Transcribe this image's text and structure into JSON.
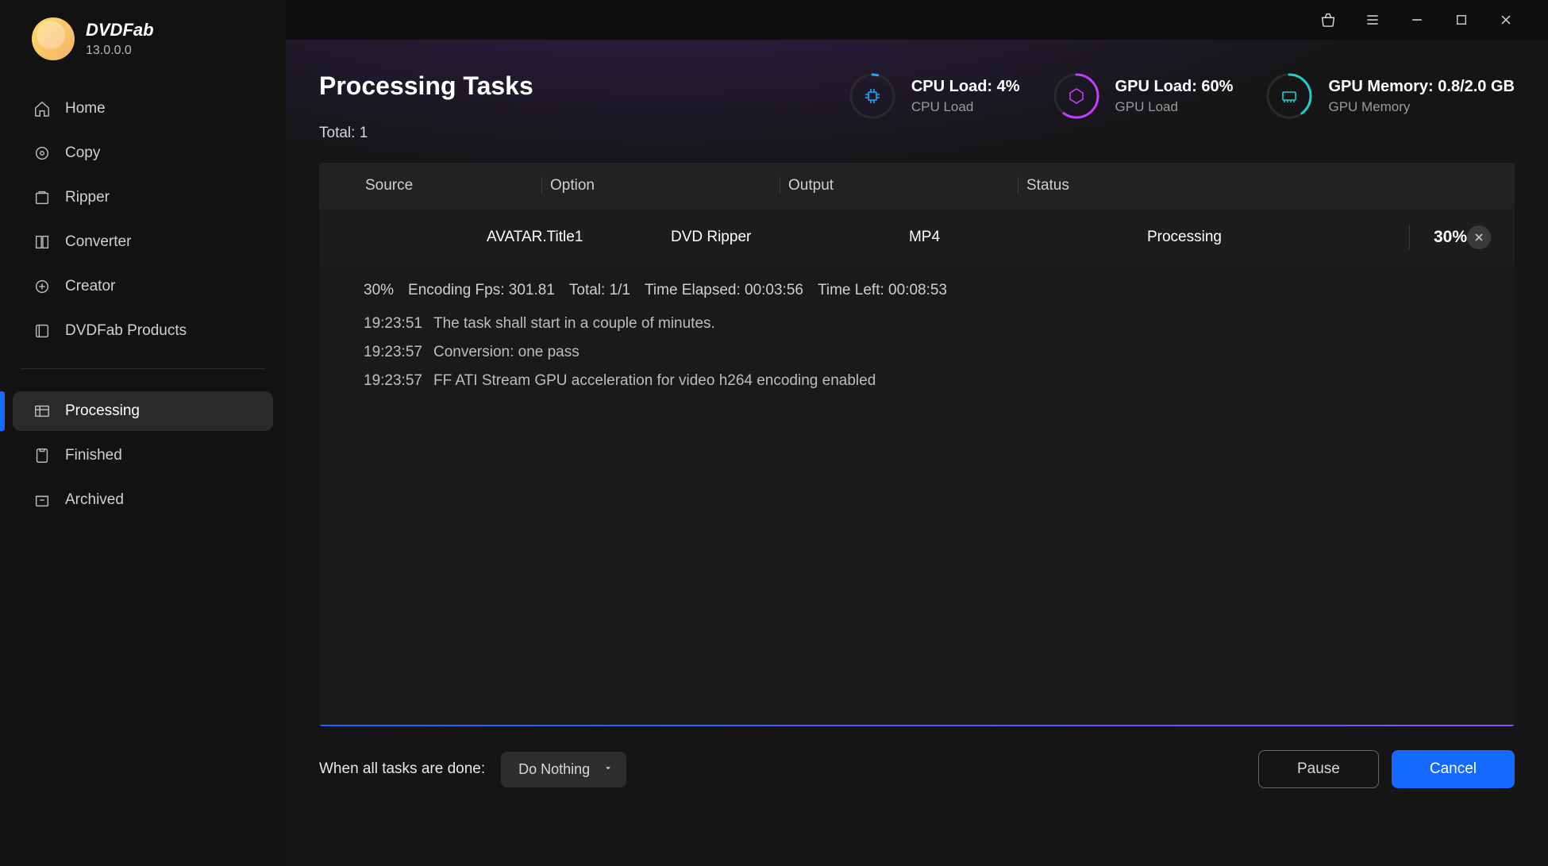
{
  "app": {
    "name": "DVDFab",
    "version": "13.0.0.0"
  },
  "sidebar": {
    "items": [
      {
        "label": "Home",
        "icon": "home-icon"
      },
      {
        "label": "Copy",
        "icon": "copy-icon"
      },
      {
        "label": "Ripper",
        "icon": "ripper-icon"
      },
      {
        "label": "Converter",
        "icon": "converter-icon"
      },
      {
        "label": "Creator",
        "icon": "creator-icon"
      },
      {
        "label": "DVDFab Products",
        "icon": "products-icon"
      }
    ],
    "taskItems": [
      {
        "label": "Processing",
        "icon": "processing-icon",
        "active": true
      },
      {
        "label": "Finished",
        "icon": "finished-icon"
      },
      {
        "label": "Archived",
        "icon": "archived-icon"
      }
    ]
  },
  "header": {
    "title": "Processing Tasks",
    "total": "Total: 1",
    "cpu": {
      "title": "CPU Load: 4%",
      "sub": "CPU Load",
      "pct": 4,
      "color": "#1aa8ff"
    },
    "gpu": {
      "title": "GPU Load: 60%",
      "sub": "GPU Load",
      "pct": 60,
      "color": "#c23cff"
    },
    "mem": {
      "title": "GPU Memory: 0.8/2.0 GB",
      "sub": "GPU Memory",
      "pct": 40,
      "color": "#1ed0c9"
    }
  },
  "table": {
    "headers": {
      "source": "Source",
      "option": "Option",
      "output": "Output",
      "status": "Status"
    },
    "task": {
      "source": "AVATAR.Title1",
      "option": "DVD Ripper",
      "output": "MP4",
      "status": "Processing",
      "percent": "30%",
      "progress": 30
    }
  },
  "log": {
    "stats": {
      "pct": "30%",
      "fps": "Encoding Fps: 301.81",
      "total": "Total: 1/1",
      "elapsed": "Time Elapsed: 00:03:56",
      "left": "Time Left: 00:08:53"
    },
    "lines": [
      {
        "time": "19:23:51",
        "msg": "The task shall start in a couple of minutes."
      },
      {
        "time": "19:23:57",
        "msg": "Conversion: one pass"
      },
      {
        "time": "19:23:57",
        "msg": "FF ATI Stream GPU acceleration for video h264 encoding enabled"
      }
    ]
  },
  "footer": {
    "label": "When all tasks are done:",
    "select": "Do Nothing",
    "pause": "Pause",
    "cancel": "Cancel"
  }
}
